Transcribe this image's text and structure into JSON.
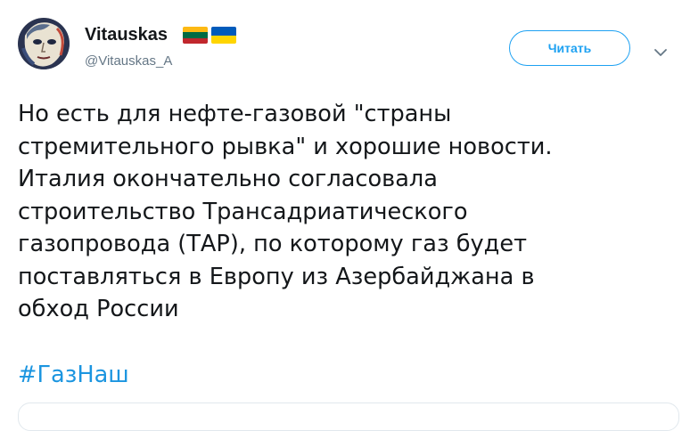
{
  "author": {
    "name": "Vitauskas",
    "handle": "@Vitauskas_A",
    "avatar": "avatar-portrait",
    "flags": [
      {
        "name": "lithuania-flag",
        "colors": [
          "#fdb913",
          "#006a44",
          "#c1272d"
        ]
      },
      {
        "name": "ukraine-flag",
        "colors": [
          "#005bbb",
          "#ffd500"
        ]
      }
    ]
  },
  "header": {
    "follow_label": "Читать",
    "more_icon": "chevron-down-icon"
  },
  "tweet": {
    "text": "Но есть для нефте-газовой \"страны\nстремительного рывка\" и хорошие новости.\nИталия окончательно согласовала\nстроительство Трансадриатического\nгазопровода (ТАР), по которому газ будет\nпоставляться в Европу из Азербайджана в\nобход России",
    "hashtag": "#ГазНаш"
  },
  "colors": {
    "accent": "#1da1f2",
    "hashtag": "#1b95e0",
    "muted": "#657786"
  }
}
